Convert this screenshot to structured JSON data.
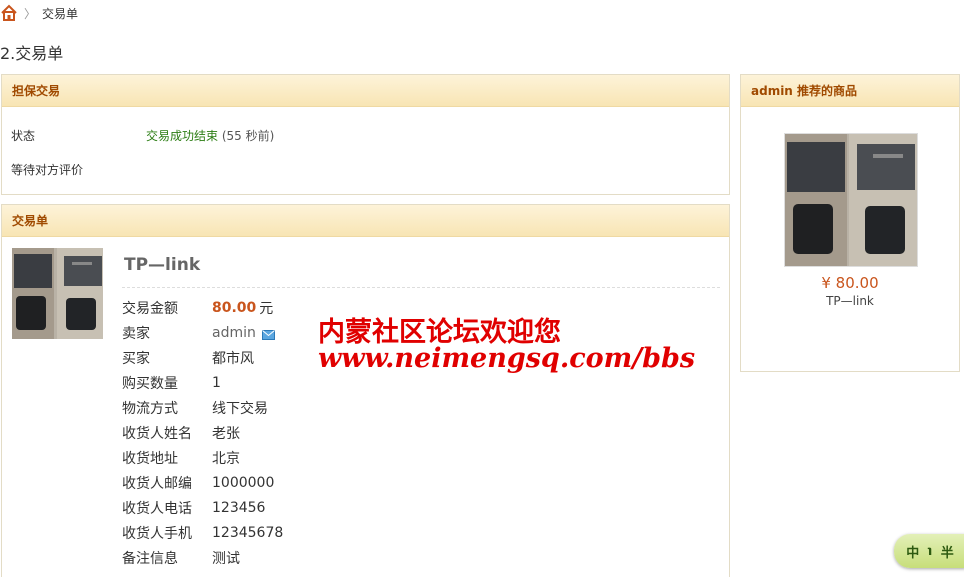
{
  "breadcrumb": {
    "home_icon": "home-icon",
    "separator": "〉",
    "current": "交易单"
  },
  "page_title": "2.交易单",
  "guarantee_panel": {
    "title": "担保交易",
    "status_label": "状态",
    "status_value": "交易成功结束",
    "status_time": "(55 秒前)",
    "waiting_text": "等待对方评价"
  },
  "order_panel": {
    "title": "交易单",
    "product_name": "TP—link",
    "rows": [
      {
        "label": "交易金额",
        "value": "80.00",
        "suffix": "元"
      },
      {
        "label": "卖家",
        "value": "admin"
      },
      {
        "label": "买家",
        "value": "都市风"
      },
      {
        "label": "购买数量",
        "value": "1"
      },
      {
        "label": "物流方式",
        "value": "线下交易"
      },
      {
        "label": "收货人姓名",
        "value": "老张"
      },
      {
        "label": "收货地址",
        "value": "北京"
      },
      {
        "label": "收货人邮编",
        "value": "1000000"
      },
      {
        "label": "收货人电话",
        "value": "123456"
      },
      {
        "label": "收货人手机",
        "value": "12345678"
      },
      {
        "label": "备注信息",
        "value": "测试"
      }
    ]
  },
  "recommend_panel": {
    "title": "admin 推荐的商品",
    "price": "¥ 80.00",
    "name": "TP—link"
  },
  "watermark": {
    "line1": "内蒙社区论坛欢迎您",
    "line2": "www.neimengsq.com/bbs"
  },
  "ime_toolbar": {
    "items": [
      "中",
      "℩",
      "半"
    ]
  },
  "colors": {
    "accent": "#a04a00",
    "price": "#c9551d",
    "status_green": "#2b7d13",
    "watermark": "#e00000"
  }
}
